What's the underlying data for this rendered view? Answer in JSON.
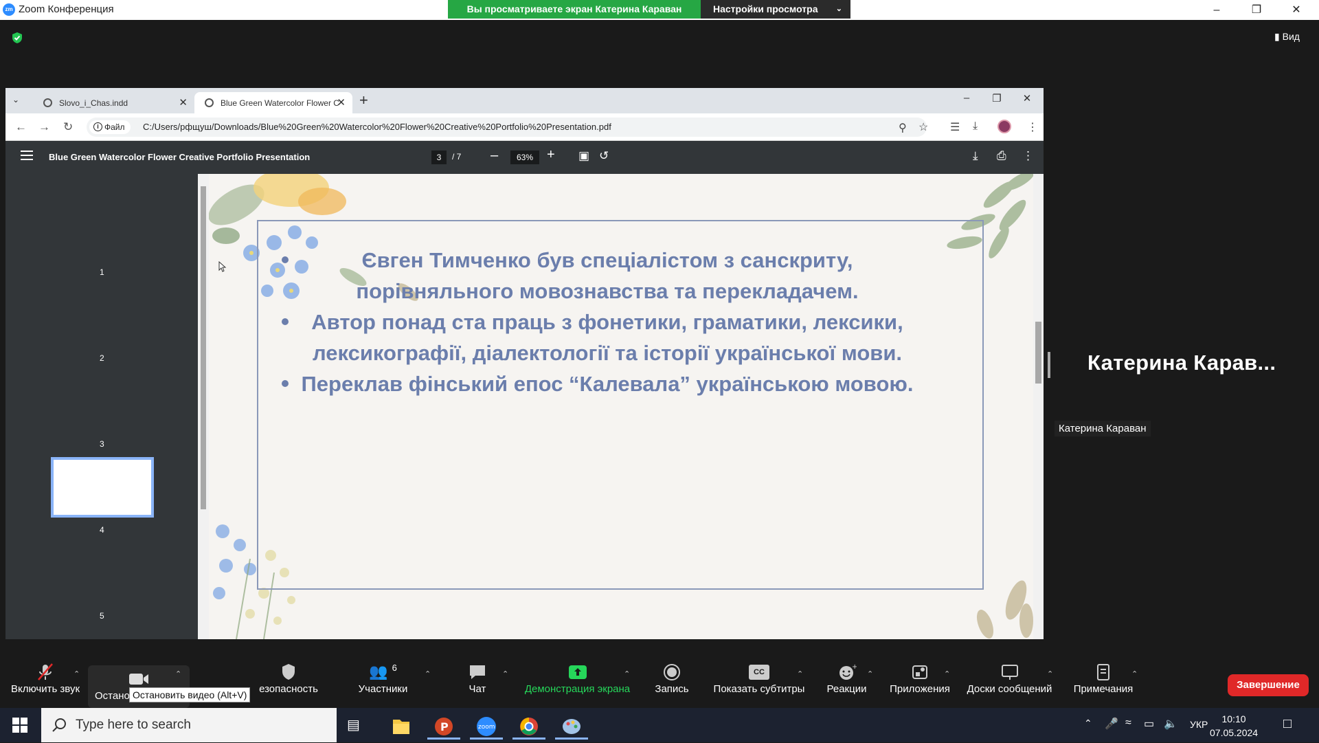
{
  "zoom": {
    "window_title": "Zoom Конференция",
    "logo_text": "zm",
    "share_banner": "Вы просматриваете экран Катерина Караван",
    "view_settings": "Настройки просмотра",
    "view_button": "Вид",
    "presenter_name": "Катерина  Карав...",
    "presenter_tag": "Катерина Караван"
  },
  "browser": {
    "tabs": [
      {
        "label": "Slovo_i_Chas.indd",
        "active": false
      },
      {
        "label": "Blue Green Watercolor Flower C",
        "active": true
      }
    ],
    "file_chip": "Файл",
    "url": "C:/Users/рфщуш/Downloads/Blue%20Green%20Watercolor%20Flower%20Creative%20Portfolio%20Presentation.pdf"
  },
  "pdf": {
    "title": "Blue Green Watercolor Flower Creative Portfolio Presentation",
    "current_page": "3",
    "page_total": "/ 7",
    "zoom": "63%",
    "thumbnails": [
      "1",
      "2",
      "3",
      "4",
      "5"
    ],
    "slide_bullets": [
      "Євген Тимченко був спеціалістом з санскриту, порівняльного мовознавства та перекладачем.",
      "Автор понад ста праць з фонетики, граматики, лексики, лексикографії, діалектології та історії української мови.",
      "Переклав фінський епос “Калевала” українською мовою."
    ],
    "colors": {
      "slide_text": "#6b7eac",
      "frame": "#8a98b8"
    }
  },
  "toolbar": {
    "unmute": "Включить звук",
    "stop_video": "Останов",
    "stop_video_tooltip": "Остановить видео (Alt+V)",
    "security": "езопасность",
    "participants": "Участники",
    "participants_count": "6",
    "chat": "Чат",
    "share_screen": "Демонстрация экрана",
    "record": "Запись",
    "captions": "Показать субтитры",
    "captions_icon": "CC",
    "reactions": "Реакции",
    "apps": "Приложения",
    "whiteboards": "Доски сообщений",
    "notes": "Примечания",
    "end": "Завершение",
    "share_color": "#26d65a"
  },
  "taskbar": {
    "search_placeholder": "Type here to search",
    "zoom_app_label": "zoom",
    "language": "УКР",
    "time": "10:10",
    "date": "07.05.2024"
  }
}
